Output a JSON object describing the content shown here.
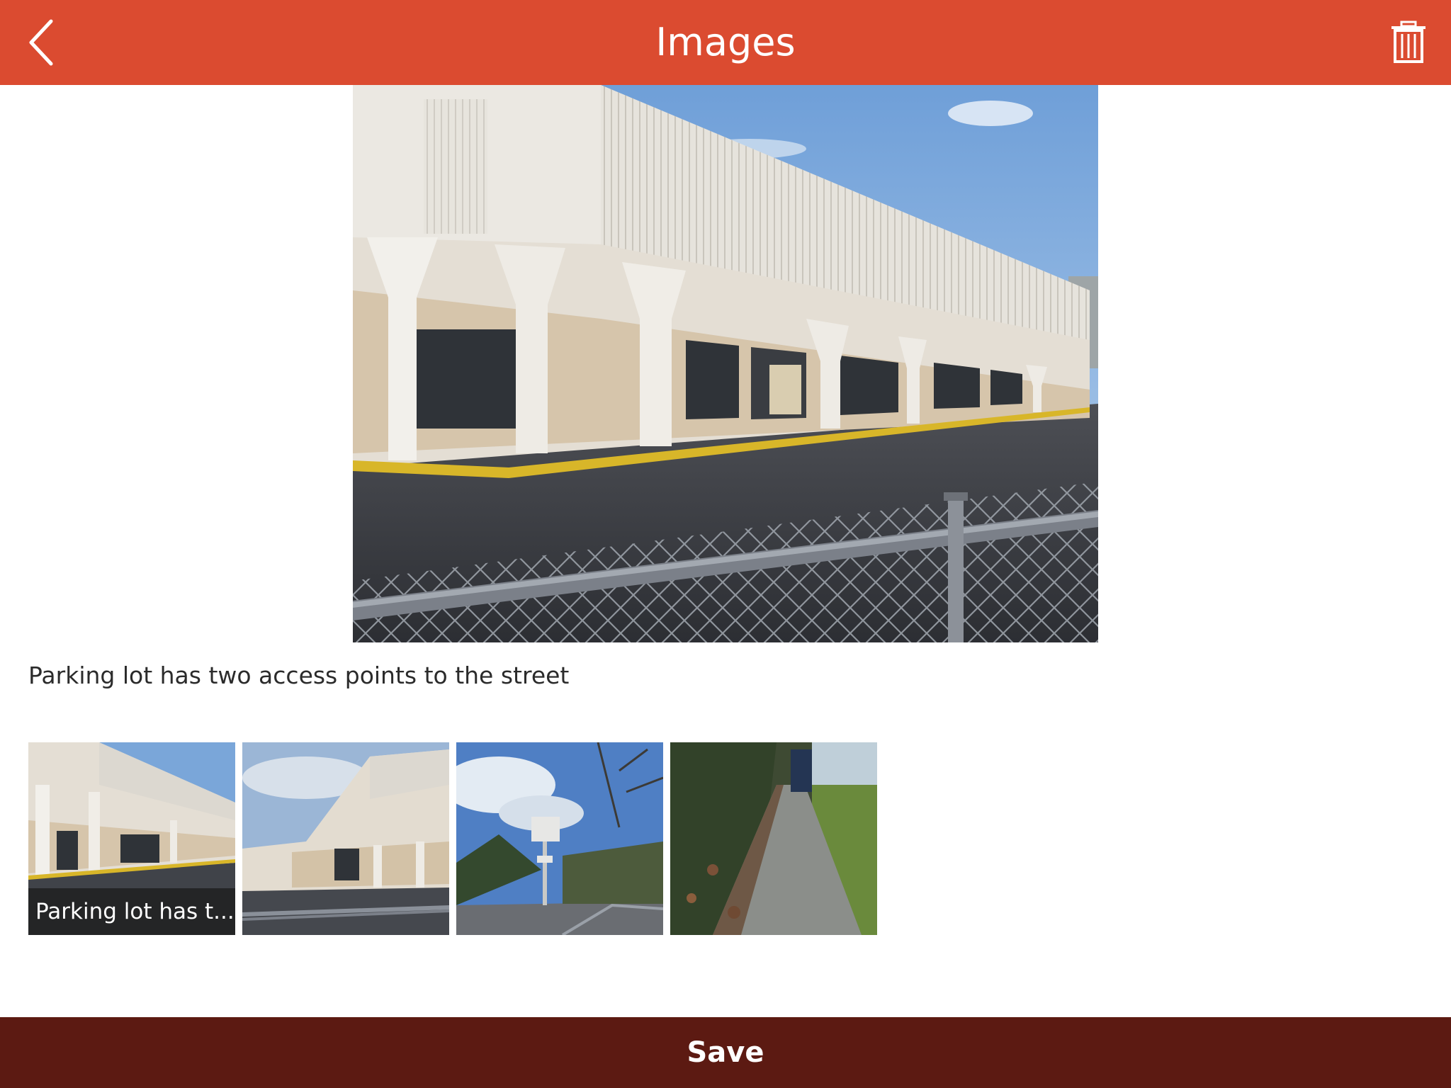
{
  "header": {
    "title": "Images",
    "back_icon": "chevron-left-icon",
    "delete_icon": "trash-icon",
    "background_color": "#db4b30"
  },
  "main_image": {
    "caption": "Parking lot has two access points to the street"
  },
  "thumbnails": [
    {
      "label": "Parking lot has t...",
      "selected": true
    },
    {
      "label": ""
    },
    {
      "label": ""
    },
    {
      "label": ""
    }
  ],
  "footer": {
    "save_label": "Save",
    "background_color": "#5c1a12"
  }
}
